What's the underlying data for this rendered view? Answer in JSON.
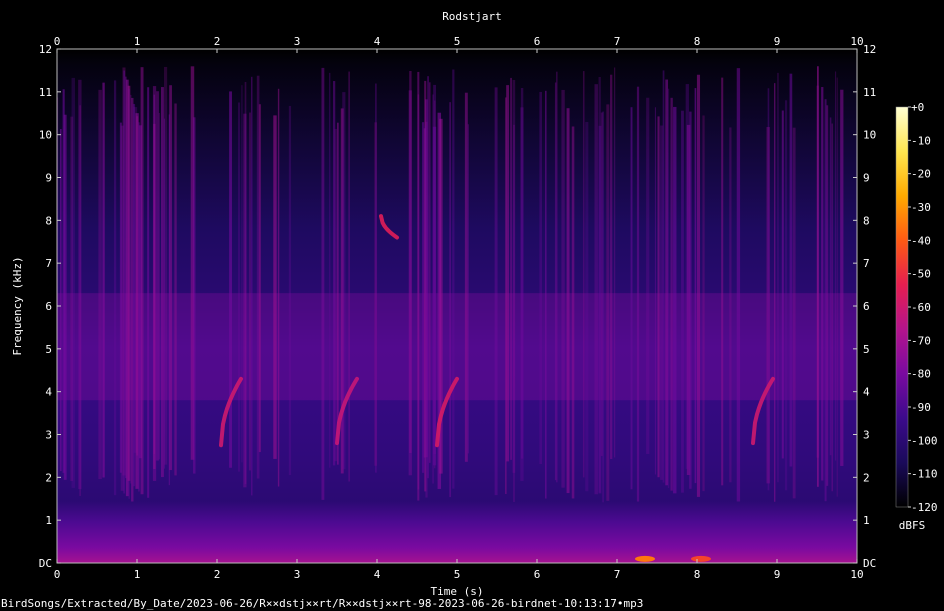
{
  "chart_data": {
    "type": "heatmap",
    "title": "Rodstjart",
    "xlabel": "Time (s)",
    "ylabel": "Frequency (kHz)",
    "xlim": [
      0,
      10
    ],
    "ylim": [
      0,
      12
    ],
    "x_ticks": [
      "0",
      "1",
      "2",
      "3",
      "4",
      "5",
      "6",
      "7",
      "8",
      "9",
      "10"
    ],
    "y_ticks": [
      "DC",
      "1",
      "2",
      "3",
      "4",
      "5",
      "6",
      "7",
      "8",
      "9",
      "10",
      "11",
      "12"
    ],
    "colorbar": {
      "label": "dBFS",
      "range": [
        -120,
        0
      ],
      "ticks": [
        "+0",
        "-10",
        "-20",
        "-30",
        "-40",
        "-50",
        "-60",
        "-70",
        "-80",
        "-90",
        "-100",
        "-110",
        "-120"
      ],
      "colors": [
        "#000000",
        "#1a0a5a",
        "#3c0a8c",
        "#7a0aa0",
        "#b4148c",
        "#e61e50",
        "#ff5a14",
        "#ffaa00",
        "#ffe650",
        "#ffffd2"
      ]
    },
    "noise_floor_khz": 11.6,
    "calls": [
      {
        "t_start": 2.05,
        "t_end": 2.3,
        "f_start_khz": 2.75,
        "f_end_khz": 4.3,
        "level_dbfs": -60
      },
      {
        "t_start": 3.5,
        "t_end": 3.75,
        "f_start_khz": 2.8,
        "f_end_khz": 4.3,
        "level_dbfs": -62
      },
      {
        "t_start": 4.75,
        "t_end": 5.0,
        "f_start_khz": 2.75,
        "f_end_khz": 4.3,
        "level_dbfs": -58
      },
      {
        "t_start": 8.7,
        "t_end": 8.95,
        "f_start_khz": 2.8,
        "f_end_khz": 4.3,
        "level_dbfs": -60
      },
      {
        "t_start": 4.05,
        "t_end": 4.25,
        "f_start_khz": 8.1,
        "f_end_khz": 7.6,
        "level_dbfs": -55
      }
    ],
    "low_freq_hotspots": [
      {
        "t": 7.35,
        "f_khz": 0.05,
        "level_dbfs": -35
      },
      {
        "t": 8.05,
        "f_khz": 0.05,
        "level_dbfs": -45
      }
    ]
  },
  "footer": {
    "path": "BirdSongs/Extracted/By_Date/2023-06-26/R××dstj××rt/R××dstj××rt-98-2023-06-26-birdnet-10:13:17•mp3"
  }
}
